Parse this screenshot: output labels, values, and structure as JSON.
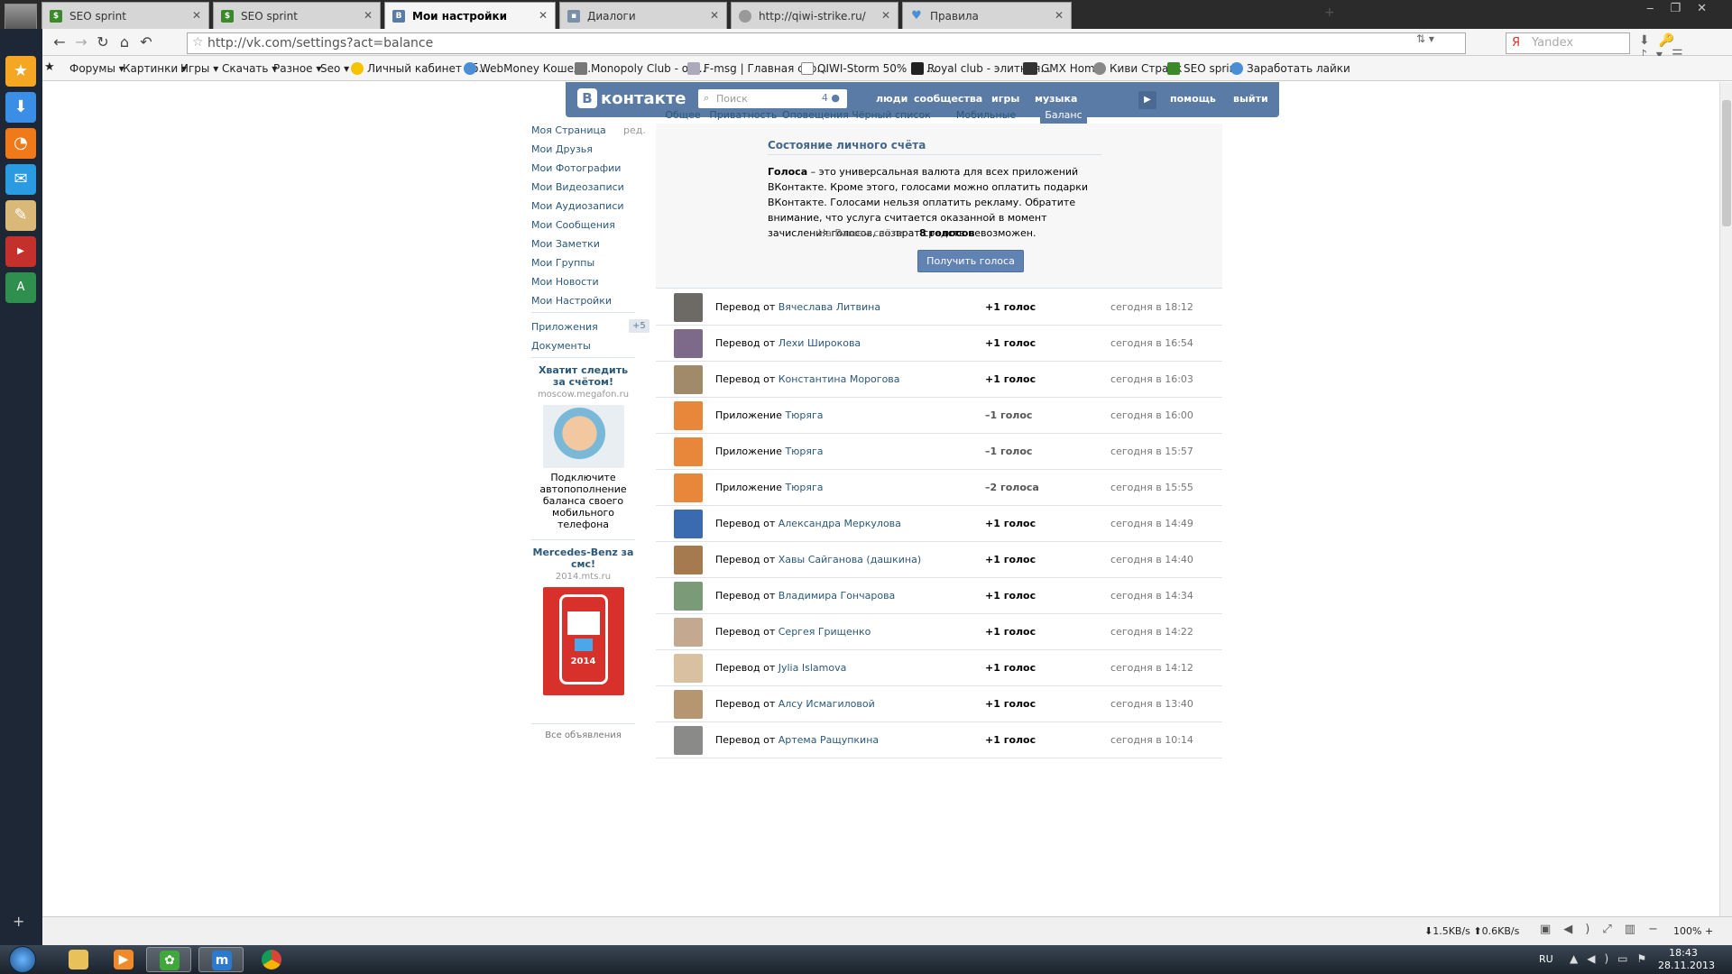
{
  "browser": {
    "tabs": [
      {
        "title": "SEO sprint",
        "active": false
      },
      {
        "title": "SEO sprint",
        "active": false
      },
      {
        "title": "Мои настройки",
        "active": true
      },
      {
        "title": "Диалоги",
        "active": false
      },
      {
        "title": "http://qiwi-strike.ru/",
        "active": false
      },
      {
        "title": "Правила",
        "active": false
      }
    ],
    "url": "http://vk.com/settings?act=balance",
    "search_placeholder": "Yandex",
    "bookmarks": [
      "Форумы ▾",
      "Картинки ▾",
      "Игры ▾",
      "Скачать ▾",
      "Разное ▾",
      "Seo ▾",
      "Личный кабинет аб...",
      "WebMoney Кошел...",
      "Monopoly Club - он...",
      "F-msg | Главная стр...",
      "QIWI-Storm 50% за ...",
      "Royal club - элитная...",
      "GMX Home",
      "Киви Страйк",
      "SEO sprint",
      "Заработать лайки"
    ]
  },
  "vk": {
    "logo": "контакте",
    "logo_letter": "В",
    "search_placeholder": "Поиск",
    "search_count": "4",
    "nav": [
      "люди",
      "сообщества",
      "игры",
      "музыка",
      "помощь",
      "выйти"
    ],
    "left_menu": [
      "Моя Страница",
      "Мои Друзья",
      "Мои Фотографии",
      "Мои Видеозаписи",
      "Мои Аудиозаписи",
      "Мои Сообщения",
      "Мои Заметки",
      "Мои Группы",
      "Мои Новости",
      "Мои Настройки"
    ],
    "left_menu_edit": "ред.",
    "apps_label": "Приложения",
    "apps_badge": "+5",
    "docs_label": "Документы",
    "ads": [
      {
        "title": "Хватит следить за счётом!",
        "domain": "moscow.megafon.ru",
        "text": "Подключите автопополнение баланса своего мобильного телефона"
      },
      {
        "title": "Mercedes-Benz за смс!",
        "domain": "2014.mts.ru",
        "text": "",
        "image_label": "2014"
      }
    ],
    "all_ads": "Все объявления",
    "settings_tabs": [
      "Общее",
      "Приватность",
      "Оповещения",
      "Чёрный список",
      "Мобильные сервисы",
      "Баланс"
    ],
    "balance": {
      "title": "Состояние личного счёта",
      "desc_bold": "Голоса",
      "desc": " – это универсальная валюта для всех приложений ВКонтакте. Кроме этого, голосами можно оплатить подарки ВКонтакте. Голосами нельзя оплатить рекламу. Обратите внимание, что услуга считается оказанной в момент зачисления голосов, возврат средств невозможен.",
      "account_label": "На Вашем счёте:",
      "account_value": "8 голосов",
      "button": "Получить голоса"
    },
    "transactions": [
      {
        "type": "Перевод от",
        "who": "Вячеслава Литвина",
        "amount": "+1 голос",
        "time": "сегодня в 18:12"
      },
      {
        "type": "Перевод от",
        "who": "Лехи Широкова",
        "amount": "+1 голос",
        "time": "сегодня в 16:54"
      },
      {
        "type": "Перевод от",
        "who": "Константина Морогова",
        "amount": "+1 голос",
        "time": "сегодня в 16:03"
      },
      {
        "type": "Приложение",
        "who": "Тюряга",
        "amount": "–1 голос",
        "time": "сегодня в 16:00"
      },
      {
        "type": "Приложение",
        "who": "Тюряга",
        "amount": "–1 голос",
        "time": "сегодня в 15:57"
      },
      {
        "type": "Приложение",
        "who": "Тюряга",
        "amount": "–2 голоса",
        "time": "сегодня в 15:55"
      },
      {
        "type": "Перевод от",
        "who": "Александра Меркулова",
        "amount": "+1 голос",
        "time": "сегодня в 14:49"
      },
      {
        "type": "Перевод от",
        "who": "Хавы Сайганова (дашкина)",
        "amount": "+1 голос",
        "time": "сегодня в 14:40"
      },
      {
        "type": "Перевод от",
        "who": "Владимира Гончарова",
        "amount": "+1 голос",
        "time": "сегодня в 14:34"
      },
      {
        "type": "Перевод от",
        "who": "Сергея Грищенко",
        "amount": "+1 голос",
        "time": "сегодня в 14:22"
      },
      {
        "type": "Перевод от",
        "who": "Jylia Islamova",
        "amount": "+1 голос",
        "time": "сегодня в 14:12"
      },
      {
        "type": "Перевод от",
        "who": "Алсу Исмагиловой",
        "amount": "+1 голос",
        "time": "сегодня в 13:40"
      },
      {
        "type": "Перевод от",
        "who": "Артема Ращупкина",
        "amount": "+1 голос",
        "time": "сегодня в 10:14"
      }
    ]
  },
  "statusbar": {
    "speed_down": "1.5KB/s",
    "speed_up": "0.6KB/s",
    "zoom": "100%"
  },
  "taskbar": {
    "lang": "RU",
    "time": "18:43",
    "date": "28.11.2013"
  },
  "colors": {
    "vk_blue": "#597ba5",
    "link": "#2b587a",
    "button": "#6183b4"
  }
}
